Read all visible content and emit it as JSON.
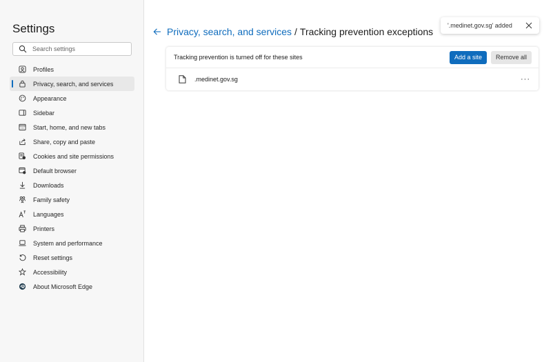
{
  "sidebar": {
    "title": "Settings",
    "search_placeholder": "Search settings",
    "items": [
      {
        "label": "Profiles",
        "icon": "profile-icon"
      },
      {
        "label": "Privacy, search, and services",
        "icon": "lock-icon",
        "active": true
      },
      {
        "label": "Appearance",
        "icon": "appearance-icon"
      },
      {
        "label": "Sidebar",
        "icon": "sidebar-icon"
      },
      {
        "label": "Start, home, and new tabs",
        "icon": "home-tabs-icon"
      },
      {
        "label": "Share, copy and paste",
        "icon": "share-icon"
      },
      {
        "label": "Cookies and site permissions",
        "icon": "cookies-icon"
      },
      {
        "label": "Default browser",
        "icon": "browser-icon"
      },
      {
        "label": "Downloads",
        "icon": "download-icon"
      },
      {
        "label": "Family safety",
        "icon": "family-icon"
      },
      {
        "label": "Languages",
        "icon": "languages-icon"
      },
      {
        "label": "Printers",
        "icon": "printer-icon"
      },
      {
        "label": "System and performance",
        "icon": "laptop-icon"
      },
      {
        "label": "Reset settings",
        "icon": "reset-icon"
      },
      {
        "label": "Accessibility",
        "icon": "accessibility-icon"
      },
      {
        "label": "About Microsoft Edge",
        "icon": "edge-icon"
      }
    ]
  },
  "header": {
    "parent_link": "Privacy, search, and services",
    "separator": "/",
    "current": "Tracking prevention exceptions"
  },
  "toast": {
    "message": "'.medinet.gov.sg' added"
  },
  "card": {
    "description": "Tracking prevention is turned off for these sites",
    "add_label": "Add a site",
    "remove_all_label": "Remove all",
    "sites": [
      {
        "name": ".medinet.gov.sg",
        "more": "···"
      }
    ]
  },
  "colors": {
    "accent": "#0f6cbd",
    "sidebar_bg": "#f7f7f7"
  }
}
